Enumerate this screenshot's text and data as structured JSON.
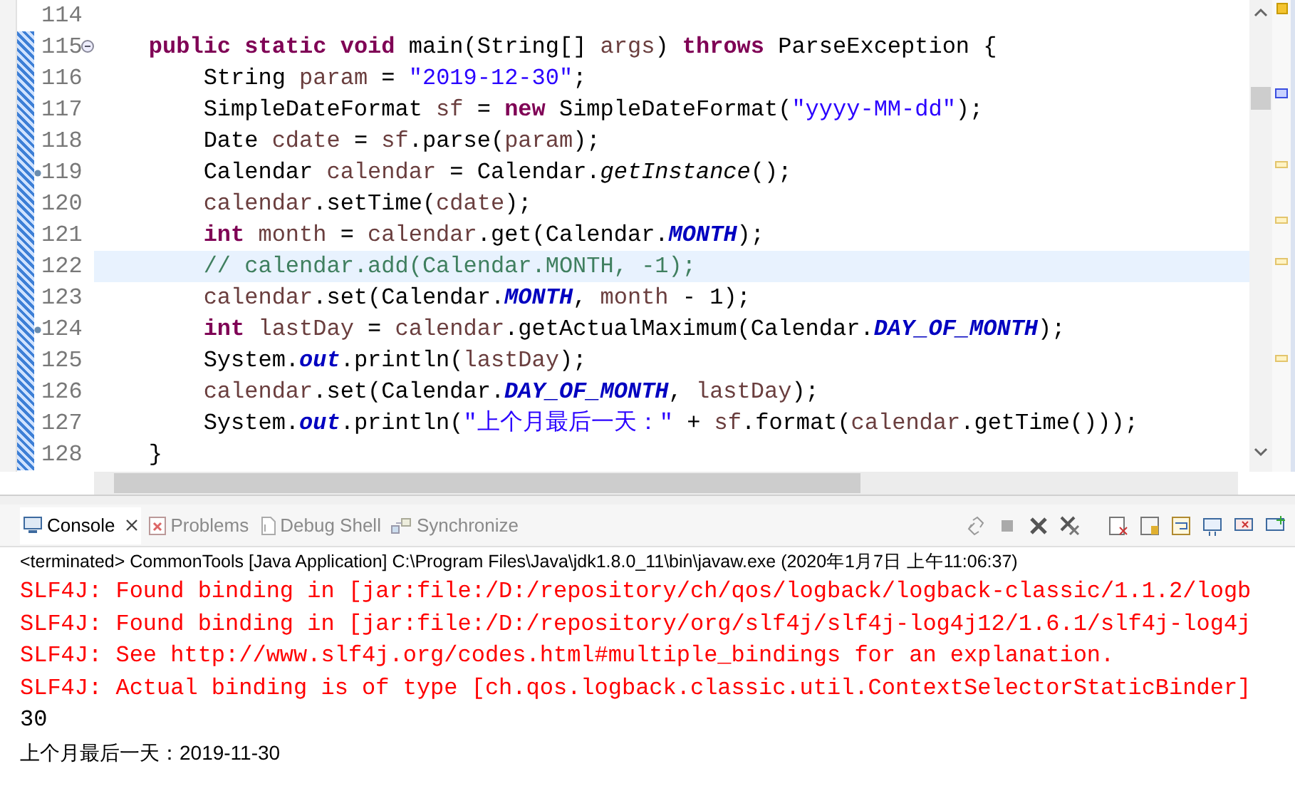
{
  "editor": {
    "lines": [
      {
        "number": "114",
        "collapse_toggle": false,
        "override_marker": false,
        "selected": false
      },
      {
        "number": "115",
        "collapse_toggle": true,
        "override_marker": false,
        "selected": false,
        "tokens": [
          {
            "kind": "keyword",
            "text": "    public"
          },
          {
            "kind": "keyword",
            "text": " static"
          },
          {
            "kind": "keyword",
            "text": " void"
          },
          {
            "kind": "plain",
            "text": " main(String[] "
          },
          {
            "kind": "local",
            "text": "args"
          },
          {
            "kind": "plain",
            "text": ") "
          },
          {
            "kind": "keyword",
            "text": "throws"
          },
          {
            "kind": "plain",
            "text": " ParseException {"
          }
        ]
      },
      {
        "number": "116",
        "collapse_toggle": false,
        "override_marker": false,
        "selected": false,
        "tokens": [
          {
            "kind": "plain",
            "text": "        String "
          },
          {
            "kind": "local",
            "text": "param"
          },
          {
            "kind": "plain",
            "text": " = "
          },
          {
            "kind": "string",
            "text": "\"2019-12-30\""
          },
          {
            "kind": "plain",
            "text": ";"
          }
        ]
      },
      {
        "number": "117",
        "collapse_toggle": false,
        "override_marker": false,
        "selected": false,
        "tokens": [
          {
            "kind": "plain",
            "text": "        SimpleDateFormat "
          },
          {
            "kind": "local",
            "text": "sf"
          },
          {
            "kind": "plain",
            "text": " = "
          },
          {
            "kind": "keyword",
            "text": "new"
          },
          {
            "kind": "plain",
            "text": " SimpleDateFormat("
          },
          {
            "kind": "string",
            "text": "\"yyyy-MM-dd\""
          },
          {
            "kind": "plain",
            "text": ");"
          }
        ]
      },
      {
        "number": "118",
        "collapse_toggle": false,
        "override_marker": false,
        "selected": false,
        "tokens": [
          {
            "kind": "plain",
            "text": "        Date "
          },
          {
            "kind": "local",
            "text": "cdate"
          },
          {
            "kind": "plain",
            "text": " = "
          },
          {
            "kind": "local",
            "text": "sf"
          },
          {
            "kind": "plain",
            "text": ".parse("
          },
          {
            "kind": "local",
            "text": "param"
          },
          {
            "kind": "plain",
            "text": ");"
          }
        ]
      },
      {
        "number": "119",
        "collapse_toggle": false,
        "override_marker": true,
        "selected": false,
        "tokens": [
          {
            "kind": "plain",
            "text": "        Calendar "
          },
          {
            "kind": "local",
            "text": "calendar"
          },
          {
            "kind": "plain",
            "text": " = Calendar."
          },
          {
            "kind": "static_method",
            "text": "getInstance"
          },
          {
            "kind": "plain",
            "text": "();"
          }
        ]
      },
      {
        "number": "120",
        "collapse_toggle": false,
        "override_marker": false,
        "selected": false,
        "tokens": [
          {
            "kind": "local",
            "text": "        calendar"
          },
          {
            "kind": "plain",
            "text": ".setTime("
          },
          {
            "kind": "local",
            "text": "cdate"
          },
          {
            "kind": "plain",
            "text": ");"
          }
        ]
      },
      {
        "number": "121",
        "collapse_toggle": false,
        "override_marker": false,
        "selected": false,
        "tokens": [
          {
            "kind": "keyword",
            "text": "        int"
          },
          {
            "kind": "local",
            "text": " month"
          },
          {
            "kind": "plain",
            "text": " = "
          },
          {
            "kind": "local",
            "text": "calendar"
          },
          {
            "kind": "plain",
            "text": ".get(Calendar."
          },
          {
            "kind": "field",
            "text": "MONTH"
          },
          {
            "kind": "plain",
            "text": ");"
          }
        ]
      },
      {
        "number": "122",
        "collapse_toggle": false,
        "override_marker": false,
        "selected": true,
        "tokens": [
          {
            "kind": "comment",
            "text": "        // calendar.add(Calendar.MONTH, -1);"
          }
        ]
      },
      {
        "number": "123",
        "collapse_toggle": false,
        "override_marker": false,
        "selected": false,
        "tokens": [
          {
            "kind": "local",
            "text": "        calendar"
          },
          {
            "kind": "plain",
            "text": ".set(Calendar."
          },
          {
            "kind": "field",
            "text": "MONTH"
          },
          {
            "kind": "plain",
            "text": ", "
          },
          {
            "kind": "local",
            "text": "month"
          },
          {
            "kind": "plain",
            "text": " - 1);"
          }
        ]
      },
      {
        "number": "124",
        "collapse_toggle": false,
        "override_marker": true,
        "selected": false,
        "tokens": [
          {
            "kind": "keyword",
            "text": "        int"
          },
          {
            "kind": "local",
            "text": " lastDay"
          },
          {
            "kind": "plain",
            "text": " = "
          },
          {
            "kind": "local",
            "text": "calendar"
          },
          {
            "kind": "plain",
            "text": ".getActualMaximum(Calendar."
          },
          {
            "kind": "field",
            "text": "DAY_OF_MONTH"
          },
          {
            "kind": "plain",
            "text": ");"
          }
        ]
      },
      {
        "number": "125",
        "collapse_toggle": false,
        "override_marker": false,
        "selected": false,
        "tokens": [
          {
            "kind": "plain",
            "text": "        System."
          },
          {
            "kind": "field",
            "text": "out"
          },
          {
            "kind": "plain",
            "text": ".println("
          },
          {
            "kind": "local",
            "text": "lastDay"
          },
          {
            "kind": "plain",
            "text": ");"
          }
        ]
      },
      {
        "number": "126",
        "collapse_toggle": false,
        "override_marker": false,
        "selected": false,
        "tokens": [
          {
            "kind": "local",
            "text": "        calendar"
          },
          {
            "kind": "plain",
            "text": ".set(Calendar."
          },
          {
            "kind": "field",
            "text": "DAY_OF_MONTH"
          },
          {
            "kind": "plain",
            "text": ", "
          },
          {
            "kind": "local",
            "text": "lastDay"
          },
          {
            "kind": "plain",
            "text": ");"
          }
        ]
      },
      {
        "number": "127",
        "collapse_toggle": false,
        "override_marker": false,
        "selected": false,
        "tokens": [
          {
            "kind": "plain",
            "text": "        System."
          },
          {
            "kind": "field",
            "text": "out"
          },
          {
            "kind": "plain",
            "text": ".println("
          },
          {
            "kind": "string",
            "text": "\"上个月最后一天：\""
          },
          {
            "kind": "plain",
            "text": " + "
          },
          {
            "kind": "local",
            "text": "sf"
          },
          {
            "kind": "plain",
            "text": ".format("
          },
          {
            "kind": "local",
            "text": "calendar"
          },
          {
            "kind": "plain",
            "text": ".getTime()));"
          }
        ]
      },
      {
        "number": "128",
        "collapse_toggle": false,
        "override_marker": false,
        "selected": false,
        "tokens": [
          {
            "kind": "plain",
            "text": "    }"
          }
        ]
      }
    ]
  },
  "console": {
    "tabs": [
      {
        "label": "Console",
        "selected": true,
        "closable": true
      },
      {
        "label": "Problems",
        "selected": false,
        "closable": false
      },
      {
        "label": "Debug Shell",
        "selected": false,
        "closable": false
      },
      {
        "label": "Synchronize",
        "selected": false,
        "closable": false
      }
    ],
    "process": "<terminated> CommonTools [Java Application] C:\\Program Files\\Java\\jdk1.8.0_11\\bin\\javaw.exe (2020年1月7日 上午11:06:37)",
    "output": [
      {
        "kind": "stderr",
        "text": "SLF4J: Found binding in [jar:file:/D:/repository/ch/qos/logback/logback-classic/1.1.2/logb"
      },
      {
        "kind": "stderr",
        "text": "SLF4J: Found binding in [jar:file:/D:/repository/org/slf4j/slf4j-log4j12/1.6.1/slf4j-log4j"
      },
      {
        "kind": "stderr",
        "text": "SLF4J: See http://www.slf4j.org/codes.html#multiple_bindings for an explanation."
      },
      {
        "kind": "stderr",
        "text": "SLF4J: Actual binding is of type [ch.qos.logback.classic.util.ContextSelectorStaticBinder]"
      },
      {
        "kind": "stdout",
        "text": "30"
      },
      {
        "kind": "stdout_cjk",
        "text": "上个月最后一天：2019-11-30"
      }
    ]
  }
}
